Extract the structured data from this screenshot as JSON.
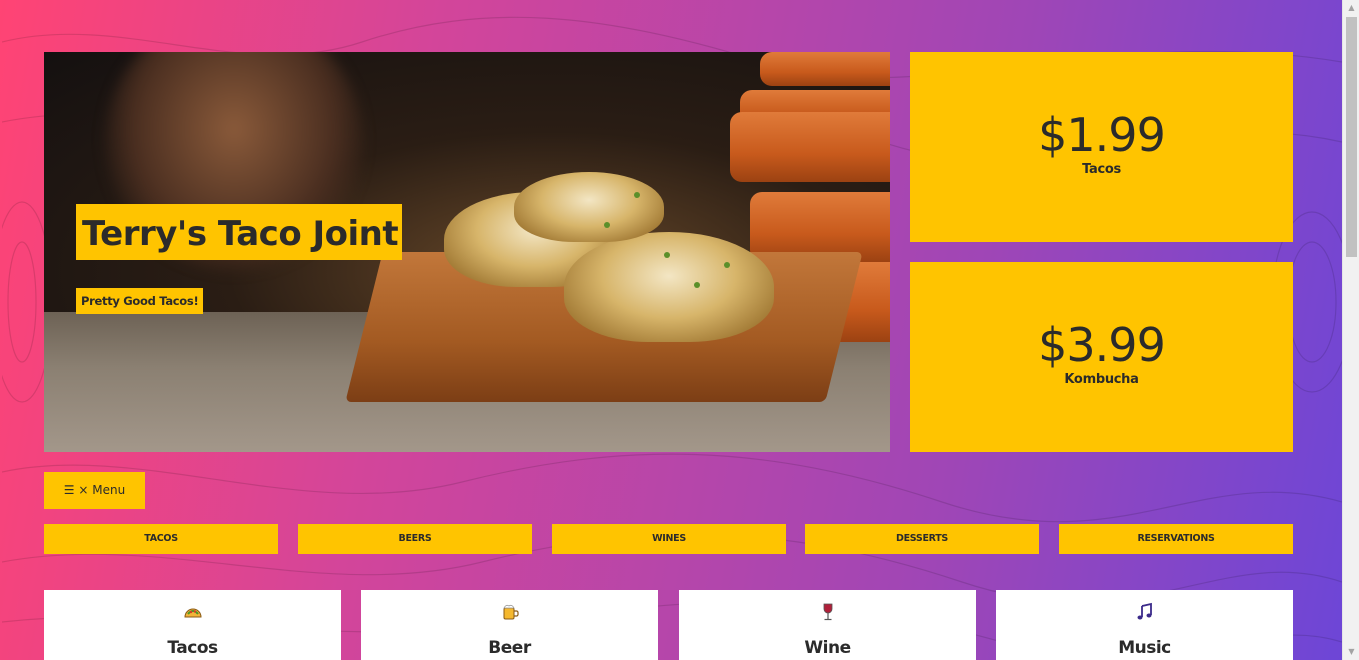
{
  "hero": {
    "title": "Terry's Taco Joint",
    "subtitle": "Pretty Good Tacos!"
  },
  "prices": [
    {
      "price": "$1.99",
      "item": "Tacos"
    },
    {
      "price": "$3.99",
      "item": "Kombucha"
    }
  ],
  "menu_toggle": {
    "label": "☰ × Menu"
  },
  "nav": {
    "items": [
      {
        "label": "TACOS"
      },
      {
        "label": "BEERS"
      },
      {
        "label": "WINES"
      },
      {
        "label": "DESSERTS"
      },
      {
        "label": "RESERVATIONS"
      }
    ]
  },
  "features": [
    {
      "icon": "taco-icon",
      "label": "Tacos"
    },
    {
      "icon": "beer-icon",
      "label": "Beer"
    },
    {
      "icon": "wine-icon",
      "label": "Wine"
    },
    {
      "icon": "music-icon",
      "label": "Music"
    }
  ],
  "colors": {
    "accent": "#ffc400",
    "text": "#2b2b2b",
    "gradient_start": "#ff4474",
    "gradient_end": "#6b46d8"
  }
}
